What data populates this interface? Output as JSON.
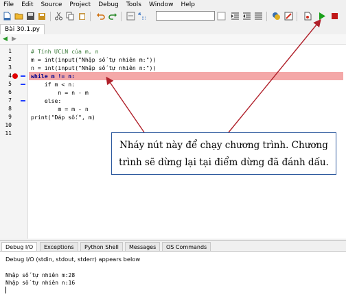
{
  "menu": [
    "File",
    "Edit",
    "Source",
    "Project",
    "Debug",
    "Tools",
    "Window",
    "Help"
  ],
  "toolbar": {
    "search_value": "",
    "icons": [
      "new-file",
      "open-file",
      "save-file",
      "save-all",
      "cut",
      "copy",
      "paste",
      "undo",
      "redo",
      "find",
      "search-input",
      "find-next",
      "indent",
      "dedent",
      "comment",
      "uncomment",
      "wing-debug",
      "wing-stop",
      "run-file",
      "debug-run",
      "stop"
    ]
  },
  "file_tab": "Bài 30.1.py",
  "editor": {
    "lines": [
      {
        "n": "1",
        "text": "# Tính ƯCLN của m, n"
      },
      {
        "n": "2",
        "text": "m = int(input(\"Nhập số tự nhiên m:\"))"
      },
      {
        "n": "3",
        "text": "n = int(input(\"Nhập số tự nhiên n:\"))"
      },
      {
        "n": "4",
        "text": "while m != n:"
      },
      {
        "n": "5",
        "text": "    if m < n:"
      },
      {
        "n": "6",
        "text": "        n = n - m"
      },
      {
        "n": "7",
        "text": "    else:"
      },
      {
        "n": "8",
        "text": "        m = m - n"
      },
      {
        "n": "9",
        "text": "print(\"Đáp số:\", m)"
      },
      {
        "n": "10",
        "text": ""
      },
      {
        "n": "11",
        "text": ""
      }
    ],
    "breakpoint_line": "4"
  },
  "bottom_tabs": [
    "Debug I/O",
    "Exceptions",
    "Python Shell",
    "Messages",
    "OS Commands"
  ],
  "console": {
    "header": "Debug I/O (stdin, stdout, stderr) appears below",
    "out1": "Nhập số tự nhiên m:28",
    "out2": "Nhập số tự nhiên n:16"
  },
  "annotation": {
    "line1": "Nháy nút này để chạy chương trình. Chương",
    "line2": "trình sẽ dừng lại tại điểm dừng đã đánh dấu."
  },
  "colors": {
    "breakpoint": "#e00000",
    "highlight": "#f4a8a8",
    "arrow": "#b0202a",
    "callout_border": "#2e5a9e"
  }
}
